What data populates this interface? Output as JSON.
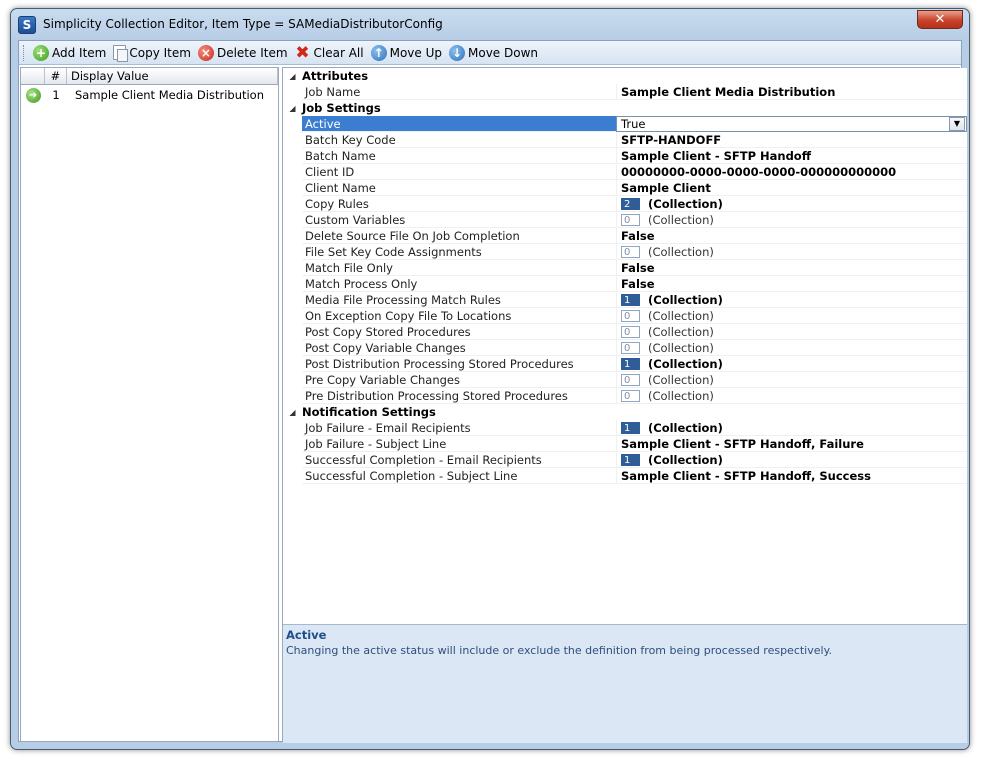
{
  "window": {
    "title": "Simplicity Collection Editor, Item Type = SAMediaDistributorConfig",
    "app_icon": "S",
    "close_glyph": "✕"
  },
  "toolbar": {
    "add_label": "Add Item",
    "copy_label": "Copy Item",
    "delete_label": "Delete Item",
    "clear_label": "Clear All",
    "move_up_label": "Move Up",
    "move_down_label": "Move Down"
  },
  "item_list": {
    "headers": {
      "num": "#",
      "display_value": "Display Value"
    },
    "rows": [
      {
        "num": "1",
        "display_value": "Sample Client Media Distribution"
      }
    ]
  },
  "property_grid": {
    "attributes": {
      "label": "Attributes",
      "job_name": {
        "name": "Job Name",
        "value": "Sample Client Media Distribution"
      }
    },
    "job_settings": {
      "label": "Job Settings",
      "active": {
        "name": "Active",
        "value": "True"
      },
      "batch_key_code": {
        "name": "Batch Key Code",
        "value": "SFTP-HANDOFF"
      },
      "batch_name": {
        "name": "Batch Name",
        "value": "Sample Client - SFTP Handoff"
      },
      "client_id": {
        "name": "Client ID",
        "value": "00000000-0000-0000-0000-000000000000"
      },
      "client_name": {
        "name": "Client Name",
        "value": "Sample Client"
      },
      "copy_rules": {
        "name": "Copy Rules",
        "count": "2",
        "value": "(Collection)"
      },
      "custom_variables": {
        "name": "Custom Variables",
        "count": "0",
        "value": "(Collection)"
      },
      "delete_source": {
        "name": "Delete Source File On Job Completion",
        "value": "False"
      },
      "file_set_key": {
        "name": "File Set Key Code Assignments",
        "count": "0",
        "value": "(Collection)"
      },
      "match_file_only": {
        "name": "Match File Only",
        "value": "False"
      },
      "match_process_only": {
        "name": "Match Process Only",
        "value": "False"
      },
      "media_match_rules": {
        "name": "Media File Processing Match Rules",
        "count": "1",
        "value": "(Collection)"
      },
      "on_exception_copy": {
        "name": "On Exception Copy File To Locations",
        "count": "0",
        "value": "(Collection)"
      },
      "post_copy_sp": {
        "name": "Post Copy Stored Procedures",
        "count": "0",
        "value": "(Collection)"
      },
      "post_copy_var": {
        "name": "Post Copy Variable Changes",
        "count": "0",
        "value": "(Collection)"
      },
      "post_dist_sp": {
        "name": "Post Distribution Processing Stored Procedures",
        "count": "1",
        "value": "(Collection)"
      },
      "pre_copy_var": {
        "name": "Pre Copy Variable Changes",
        "count": "0",
        "value": "(Collection)"
      },
      "pre_dist_sp": {
        "name": "Pre Distribution Processing Stored Procedures",
        "count": "0",
        "value": "(Collection)"
      }
    },
    "notification_settings": {
      "label": "Notification Settings",
      "job_failure_email": {
        "name": "Job Failure - Email Recipients",
        "count": "1",
        "value": "(Collection)"
      },
      "job_failure_subject": {
        "name": "Job Failure - Subject Line",
        "value": "Sample Client - SFTP Handoff, Failure"
      },
      "success_email": {
        "name": "Successful Completion - Email Recipients",
        "count": "1",
        "value": "(Collection)"
      },
      "success_subject": {
        "name": "Successful Completion - Subject Line",
        "value": "Sample Client - SFTP Handoff, Success"
      }
    }
  },
  "description": {
    "title": "Active",
    "text": "Changing the active status will include or exclude the definition from being processed respectively."
  }
}
